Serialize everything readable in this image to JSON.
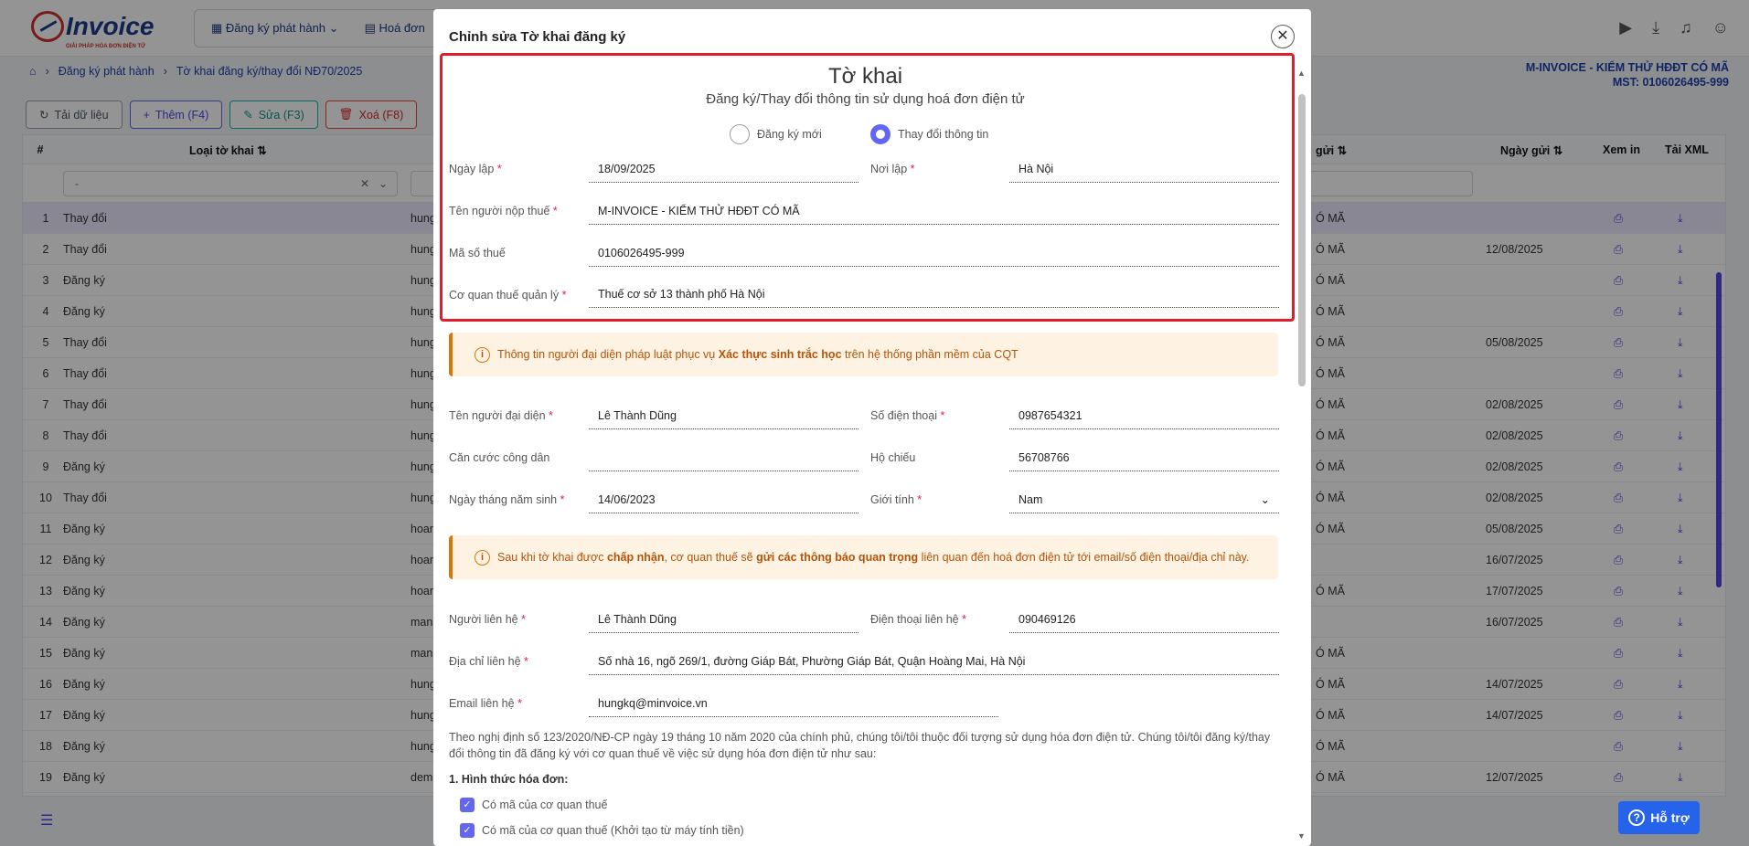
{
  "app": {
    "logo": "Invoice",
    "logo_sub": "GIẢI PHÁP HÓA ĐƠN ĐIỆN TỬ"
  },
  "nav": {
    "item1": "Đăng ký phát hành",
    "item2": "Hoá đơn"
  },
  "breadcrumb": {
    "item1": "Đăng ký phát hành",
    "item2": "Tờ khai đăng ký/thay đổi NĐ70/2025"
  },
  "company": {
    "name": "M-INVOICE - KIỂM THỬ HĐĐT CÓ MÃ",
    "mst": "MST: 0106026495-999"
  },
  "toolbar": {
    "reload": "Tải dữ liệu",
    "add": "Thêm (F4)",
    "edit": "Sửa (F3)",
    "delete": "Xoá (F8)"
  },
  "table": {
    "col_no": "#",
    "col_type": "Loại tờ khai",
    "col_sender": "gửi",
    "col_date": "Ngày gửi",
    "col_print": "Xem in",
    "col_xml": "Tải XML",
    "filter_value": "-",
    "rows": [
      {
        "n": "1",
        "type": "Thay đổi",
        "who": "hung",
        "ma": "Ó MÃ",
        "date": ""
      },
      {
        "n": "2",
        "type": "Thay đổi",
        "who": "hung",
        "ma": "Ó MÃ",
        "date": "12/08/2025"
      },
      {
        "n": "3",
        "type": "Đăng ký",
        "who": "hung",
        "ma": "Ó MÃ",
        "date": ""
      },
      {
        "n": "4",
        "type": "Đăng ký",
        "who": "hung",
        "ma": "Ó MÃ",
        "date": ""
      },
      {
        "n": "5",
        "type": "Thay đổi",
        "who": "hung",
        "ma": "Ó MÃ",
        "date": "05/08/2025"
      },
      {
        "n": "6",
        "type": "Thay đổi",
        "who": "hung",
        "ma": "Ó MÃ",
        "date": ""
      },
      {
        "n": "7",
        "type": "Thay đổi",
        "who": "hung",
        "ma": "Ó MÃ",
        "date": "02/08/2025"
      },
      {
        "n": "8",
        "type": "Thay đổi",
        "who": "hung",
        "ma": "Ó MÃ",
        "date": "02/08/2025"
      },
      {
        "n": "9",
        "type": "Đăng ký",
        "who": "hung",
        "ma": "Ó MÃ",
        "date": "02/08/2025"
      },
      {
        "n": "10",
        "type": "Thay đổi",
        "who": "hung",
        "ma": "Ó MÃ",
        "date": "02/08/2025"
      },
      {
        "n": "11",
        "type": "Đăng ký",
        "who": "hoar",
        "ma": "Ó MÃ",
        "date": "05/08/2025"
      },
      {
        "n": "12",
        "type": "Đăng ký",
        "who": "hoar",
        "ma": "",
        "date": "16/07/2025"
      },
      {
        "n": "13",
        "type": "Đăng ký",
        "who": "hoar",
        "ma": "Ó MÃ",
        "date": "17/07/2025"
      },
      {
        "n": "14",
        "type": "Đăng ký",
        "who": "manu",
        "ma": "",
        "date": "16/07/2025"
      },
      {
        "n": "15",
        "type": "Đăng ký",
        "who": "manu",
        "ma": "Ó MÃ",
        "date": ""
      },
      {
        "n": "16",
        "type": "Đăng ký",
        "who": "hung",
        "ma": "Ó MÃ",
        "date": "14/07/2025"
      },
      {
        "n": "17",
        "type": "Đăng ký",
        "who": "hung",
        "ma": "Ó MÃ",
        "date": "14/07/2025"
      },
      {
        "n": "18",
        "type": "Đăng ký",
        "who": "hung",
        "ma": "Ó MÃ",
        "date": ""
      },
      {
        "n": "19",
        "type": "Đăng ký",
        "who": "demo",
        "ma": "Ó MÃ",
        "date": "12/07/2025"
      }
    ]
  },
  "modal": {
    "title": "Chỉnh sửa Tờ khai đăng ký",
    "heading": "Tờ khai",
    "subheading": "Đăng ký/Thay đổi thông tin sử dụng hoá đơn điện tử",
    "radio_new": "Đăng ký mới",
    "radio_change": "Thay đổi thông tin",
    "selected": "Thay đổi thông tin",
    "labels": {
      "ngay_lap": "Ngày lập",
      "noi_lap": "Nơi lập",
      "ten_nnt": "Tên người nộp thuế",
      "mst": "Mã số thuế",
      "cqt": "Cơ quan thuế quản lý",
      "ten_dd": "Tên người đại diện",
      "sdt": "Số điện thoại",
      "cccd": "Căn cước công dân",
      "ho_chieu": "Hộ chiếu",
      "ngay_sinh": "Ngày tháng năm sinh",
      "gioi_tinh": "Giới tính",
      "nguoi_lh": "Người liên hệ",
      "dt_lh": "Điện thoại liên hệ",
      "dc_lh": "Địa chỉ liên hệ",
      "email_lh": "Email liên hệ"
    },
    "values": {
      "ngay_lap": "18/09/2025",
      "noi_lap": "Hà Nội",
      "ten_nnt": "M-INVOICE - KIỂM THỬ HĐĐT CÓ MÃ",
      "mst": "0106026495-999",
      "cqt": "Thuế cơ sở 13 thành phố Hà Nội",
      "ten_dd": "Lê Thành Dũng",
      "sdt": "0987654321",
      "cccd": "",
      "ho_chieu": "56708766",
      "ngay_sinh": "14/06/2023",
      "gioi_tinh": "Nam",
      "nguoi_lh": "Lê Thành Dũng",
      "dt_lh": "090469126",
      "dc_lh": "Số nhà 16, ngõ 269/1, đường Giáp Bát, Phường Giáp Bát, Quận Hoàng Mai, Hà Nội",
      "email_lh": "hungkq@minvoice.vn"
    },
    "note1": {
      "a": "Thông tin người đại diện pháp luật phục vụ ",
      "b": "Xác thực sinh trắc học",
      "c": " trên hệ thống phần mềm của CQT"
    },
    "note2": {
      "a": "Sau khi tờ khai được ",
      "b": "chấp nhận",
      "c": ", cơ quan thuế sẽ ",
      "d": "gửi các thông báo quan trọng",
      "e": " liên quan đến hoá đơn điện tử tới email/số điện thoại/địa chỉ này."
    },
    "paragraph": "Theo nghị định số 123/2020/NĐ-CP ngày 19 tháng 10 năm 2020 của chính phủ, chúng tôi/tôi thuộc đối tượng sử dụng hóa đơn điện tử. Chúng tôi/tôi đăng ký/thay đổi thông tin đã đăng ký với cơ quan thuế về việc sử dụng hóa đơn điện tử như sau:",
    "section1": "1. Hình thức hóa đơn:",
    "check1": "Có mã của cơ quan thuế",
    "check2": "Có mã của cơ quan thuế (Khởi tạo từ máy tính tiền)"
  },
  "help": {
    "label": "Hỗ trợ"
  },
  "colors": {
    "accent": "#6366f1",
    "highlight": "#e11d2b",
    "note_bg": "#fef3e2",
    "note_text": "#b45309"
  }
}
